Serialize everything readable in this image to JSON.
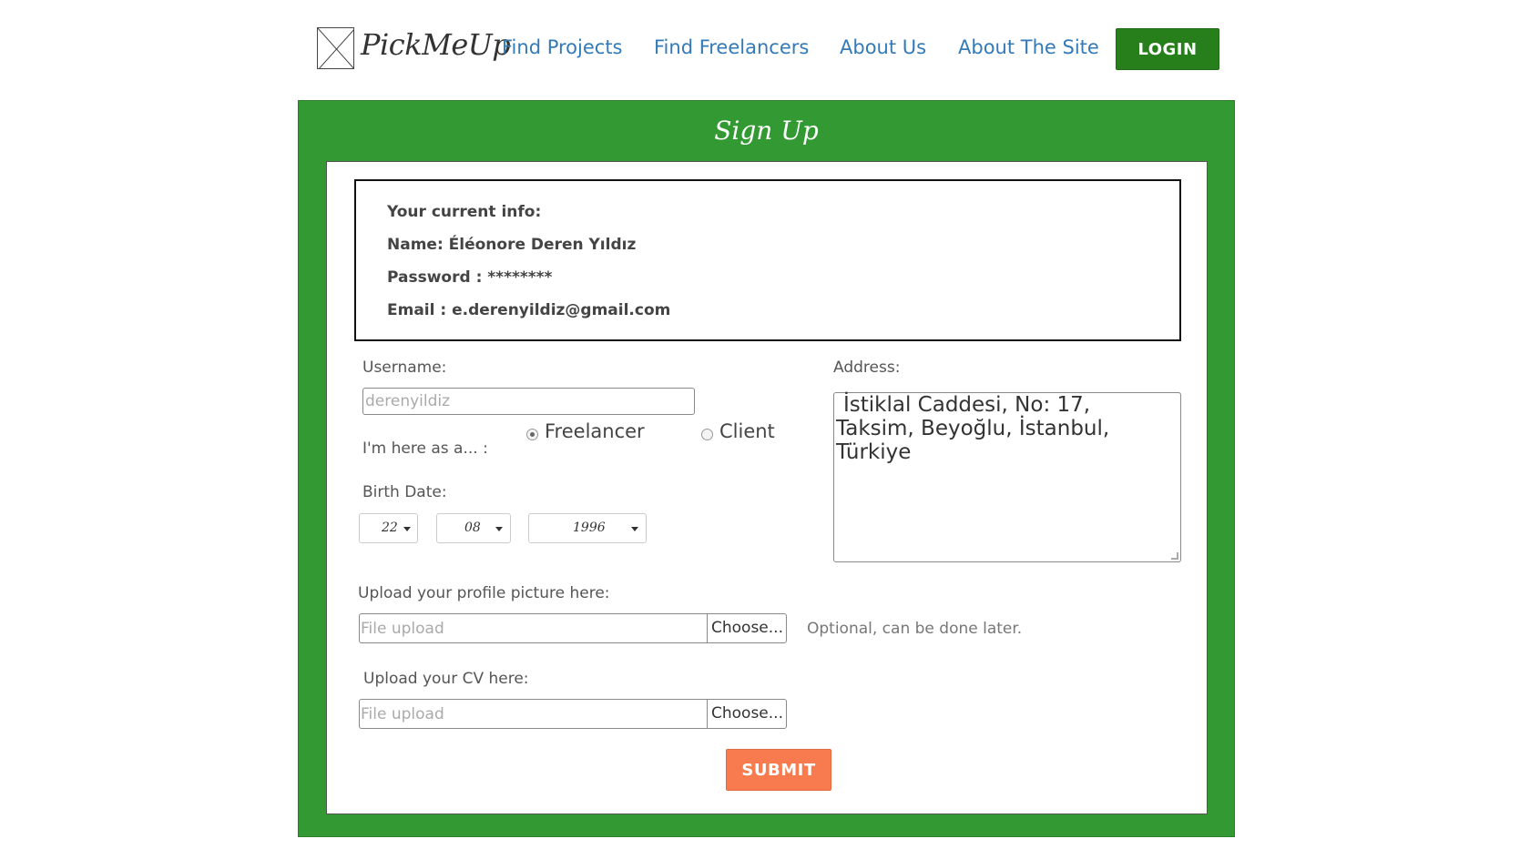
{
  "header": {
    "brand": "PickMeUp",
    "nav": [
      "Find Projects",
      "Find Freelancers",
      "About Us",
      "About The Site"
    ],
    "login_label": "LOGIN"
  },
  "form": {
    "title": "Sign Up",
    "info": {
      "heading": "Your current info:",
      "name": "Name: Éléonore Deren Yıldız",
      "password": "Password : ********",
      "email": "Email : e.derenyildiz@gmail.com"
    },
    "username_label": "Username:",
    "username_value": "derenyildiz",
    "role_label": "I'm here as a... :",
    "role_options": [
      "Freelancer",
      "Client"
    ],
    "role_selected": "Freelancer",
    "birth_label": "Birth Date:",
    "birth": {
      "day": "22",
      "month": "08",
      "year": "1996"
    },
    "address_label": "Address:",
    "address_lines": [
      "İstiklal Caddesi, No: 17,",
      "Taksim, Beyoğlu, İstanbul,",
      "Türkiye"
    ],
    "picture_label": "Upload your profile picture here:",
    "cv_label": "Upload your CV here:",
    "file_placeholder": "File upload",
    "choose_label": "Choose...",
    "optional_hint": "Optional, can be done later.",
    "submit_label": "SUBMIT"
  },
  "colors": {
    "frame_green": "#339933",
    "login_green": "#267f1b",
    "submit_orange": "#f77b4e",
    "link_blue": "#337ab7"
  }
}
